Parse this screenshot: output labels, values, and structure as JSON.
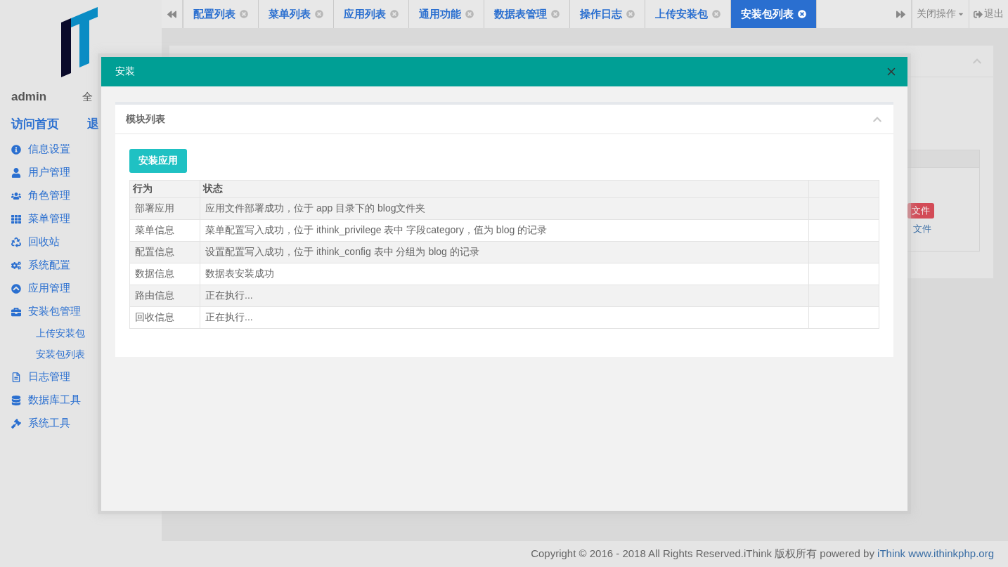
{
  "sidebar": {
    "user": "admin",
    "user_link": "全",
    "links": [
      "访问首页",
      "退"
    ],
    "menu": [
      {
        "label": "信息设置"
      },
      {
        "label": "用户管理"
      },
      {
        "label": "角色管理"
      },
      {
        "label": "菜单管理"
      },
      {
        "label": "回收站"
      },
      {
        "label": "系统配置"
      },
      {
        "label": "应用管理"
      },
      {
        "label": "安装包管理",
        "children": [
          {
            "label": "上传安装包"
          },
          {
            "label": "安装包列表"
          }
        ]
      },
      {
        "label": "日志管理"
      },
      {
        "label": "数据库工具"
      },
      {
        "label": "系统工具"
      }
    ]
  },
  "tabs": [
    {
      "label": "配置列表",
      "selected": false
    },
    {
      "label": "菜单列表",
      "selected": false
    },
    {
      "label": "应用列表",
      "selected": false
    },
    {
      "label": "通用功能",
      "selected": false
    },
    {
      "label": "数据表管理",
      "selected": false
    },
    {
      "label": "操作日志",
      "selected": false
    },
    {
      "label": "上传安装包",
      "selected": false
    },
    {
      "label": "安装包列表",
      "selected": true
    }
  ],
  "tab_actions": {
    "close_menu": "关闭操作",
    "logout": "退出"
  },
  "background_panel": {
    "badge": "文件",
    "link": "文件"
  },
  "dialog": {
    "title": "安装",
    "card_title": "模块列表",
    "button": "安装应用",
    "table": {
      "columns": [
        "行为",
        "状态"
      ],
      "rows": [
        [
          "部署应用",
          "应用文件部署成功，位于 app 目录下的 blog文件夹"
        ],
        [
          "菜单信息",
          "菜单配置写入成功，位于 ithink_privilege 表中 字段category，值为 blog 的记录"
        ],
        [
          "配置信息",
          "设置配置写入成功，位于 ithink_config 表中 分组为 blog 的记录"
        ],
        [
          "数据信息",
          "数据表安装成功"
        ],
        [
          "路由信息",
          "正在执行..."
        ],
        [
          "回收信息",
          "正在执行..."
        ]
      ]
    }
  },
  "footer": {
    "text": "Copyright © 2016 - 2018 All Rights Reserved.iThink 版权所有 powered by",
    "links": [
      "iThink",
      "www.ithinkphp.org"
    ]
  }
}
